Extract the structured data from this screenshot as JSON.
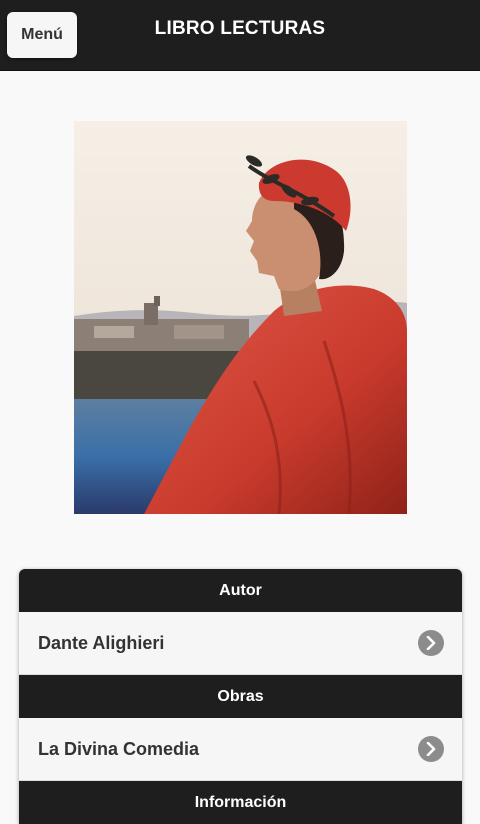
{
  "header": {
    "menu_label": "Menú",
    "title": "LIBRO LECTURAS"
  },
  "portrait": {
    "subject": "Dante Alighieri portrait",
    "colors": {
      "robe": "#c83a2c",
      "sky": "#f0e7da",
      "water": "#3a6fa8"
    }
  },
  "list": {
    "sections": [
      {
        "divider": "Autor",
        "items": [
          {
            "label": "Dante Alighieri",
            "icon": "chevron-right-icon"
          }
        ]
      },
      {
        "divider": "Obras",
        "items": [
          {
            "label": "La Divina Comedia",
            "icon": "chevron-right-icon"
          }
        ]
      },
      {
        "divider": "Información",
        "items": []
      }
    ]
  },
  "colors": {
    "bar": "#1e1e1e",
    "page": "#f9f9f9",
    "item_bg": "#f6f6f6",
    "chevron_bg": "#8c8c8c"
  }
}
